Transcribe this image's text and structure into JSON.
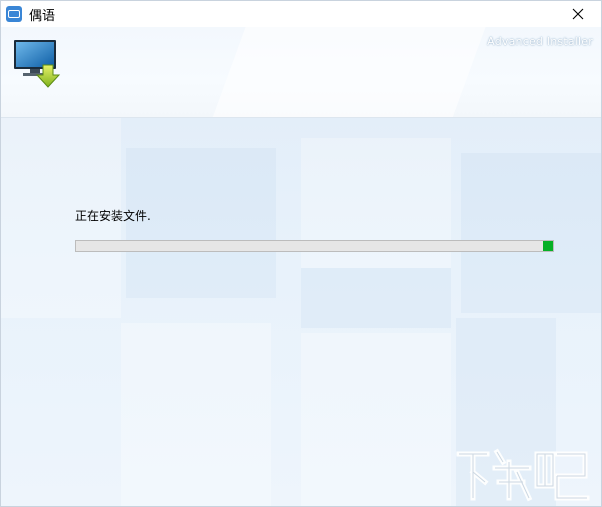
{
  "window": {
    "title": "偶语",
    "app_icon": "app-logo-icon",
    "close_icon": "close-icon"
  },
  "header": {
    "brand": "Advanced Installer",
    "icon": "computer-download-icon"
  },
  "install": {
    "status_text": "正在安装文件.",
    "progress_percent": 98
  },
  "colors": {
    "progress_fill": "#06b025",
    "progress_track": "#e6e6e6",
    "content_bg": "#e3eef9"
  },
  "watermark": {
    "icon": "xiazaiba-watermark-logo"
  }
}
